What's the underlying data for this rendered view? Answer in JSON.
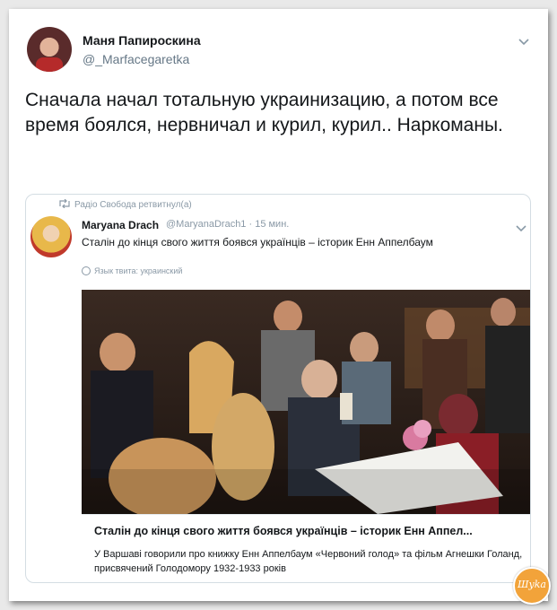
{
  "tweet": {
    "author_name": "Маня Папироскина",
    "author_handle": "@_Marfacegaretka",
    "text": "Сначала начал тотальную украинизацию, а потом все время боялся, нервничал и курил, курил.. Наркоманы."
  },
  "quoted": {
    "retweet_label": "Радіо Свобода ретвитнул(а)",
    "author_name": "Maryana Drach",
    "meta": "@MaryanaDrach1 · 15 мин.",
    "text": "Сталін до кінця свого життя боявся українців – історик Енн Аппелбаум",
    "language_label": "Язык твита: украинский",
    "card": {
      "title": "Сталін до кінця свого життя боявся українців – історик Енн Аппел...",
      "description": "У Варшаві говорили про книжку Енн Аппелбаум «Червоний голод» та фільм Агнешки Голанд, присвячений Голодомору 1932-1933 років"
    }
  },
  "icons": {
    "menu": "chevron-down-icon",
    "retweet": "retweet-icon",
    "language": "globe-icon"
  },
  "watermark": "Шyka",
  "colors": {
    "text": "#14171a",
    "muted": "#657786",
    "border": "#d4dde3",
    "watermark": "#f2a33a"
  }
}
